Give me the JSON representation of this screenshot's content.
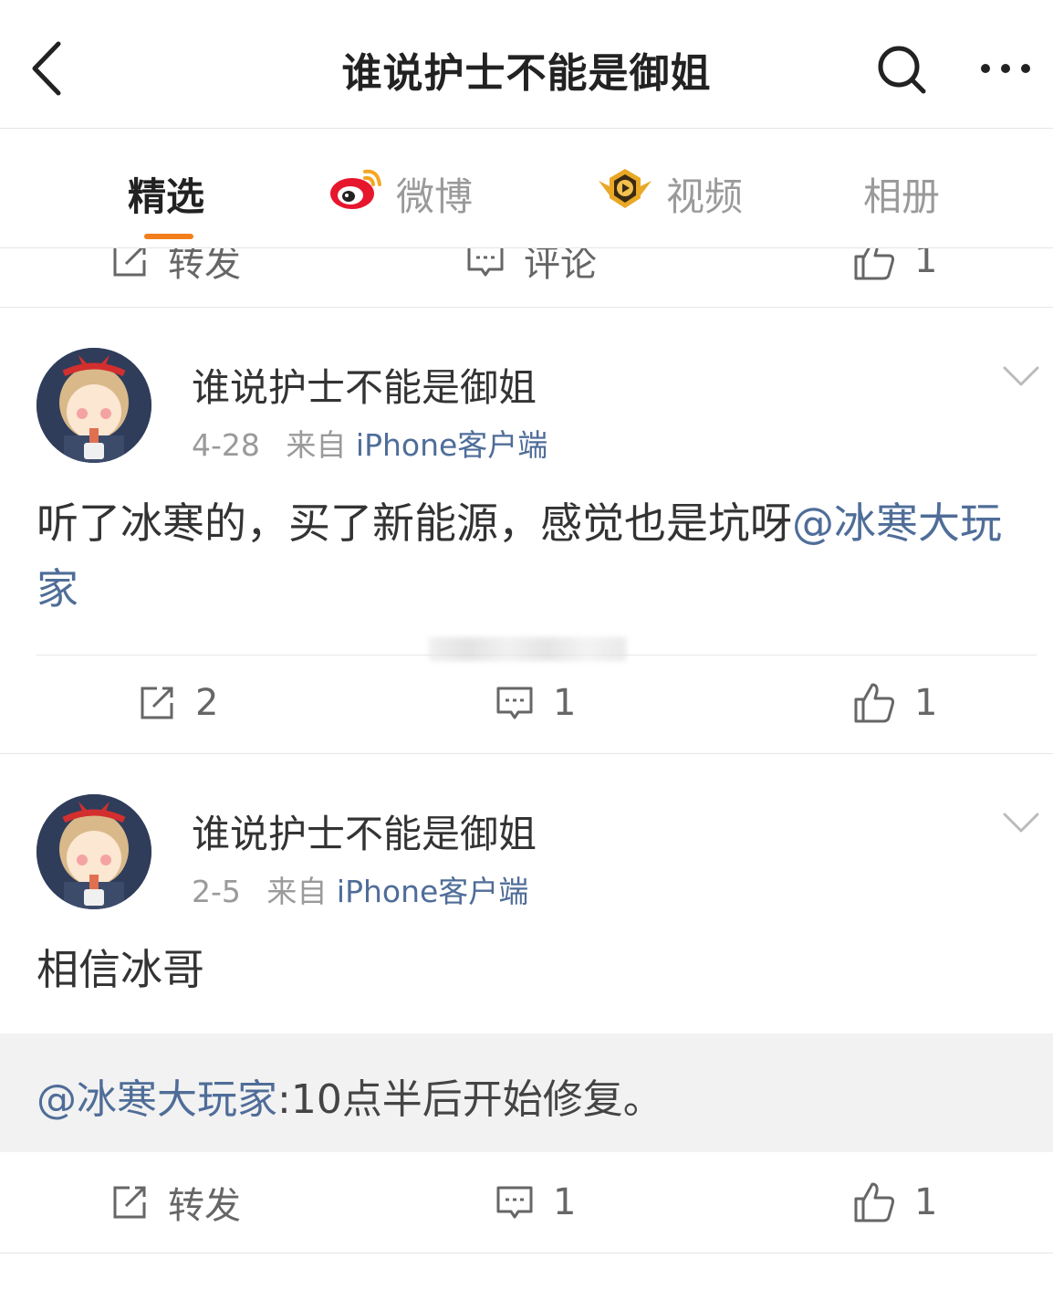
{
  "nav": {
    "title": "谁说护士不能是御姐",
    "back_icon": "back-arrow-icon",
    "search_icon": "search-icon",
    "more_icon": "more-dots-icon"
  },
  "tabs": [
    {
      "label": "精选",
      "active": true
    },
    {
      "label": "微博",
      "icon": "weibo-logo-icon"
    },
    {
      "label": "视频",
      "icon": "video-badge-icon"
    },
    {
      "label": "相册"
    }
  ],
  "accent_color": "#f27f1b",
  "link_color": "#4f6d98",
  "partial_actions": {
    "repost_label": "转发",
    "comment_label": "评论",
    "like_count": "1"
  },
  "posts": [
    {
      "username": "谁说护士不能是御姐",
      "date": "4-28",
      "source_prefix": "来自",
      "source": "iPhone客户端",
      "text": "听了冰寒的，买了新能源，感觉也是坑呀",
      "mention": "@冰寒大玩家",
      "repost_count": "2",
      "comment_count": "1",
      "like_count": "1"
    },
    {
      "username": "谁说护士不能是御姐",
      "date": "2-5",
      "source_prefix": "来自",
      "source": "iPhone客户端",
      "text": "相信冰哥",
      "quote": {
        "mention": "@冰寒大玩家",
        "text": ":10点半后开始修复。"
      },
      "repost_label": "转发",
      "comment_count": "1",
      "like_count": "1"
    }
  ]
}
